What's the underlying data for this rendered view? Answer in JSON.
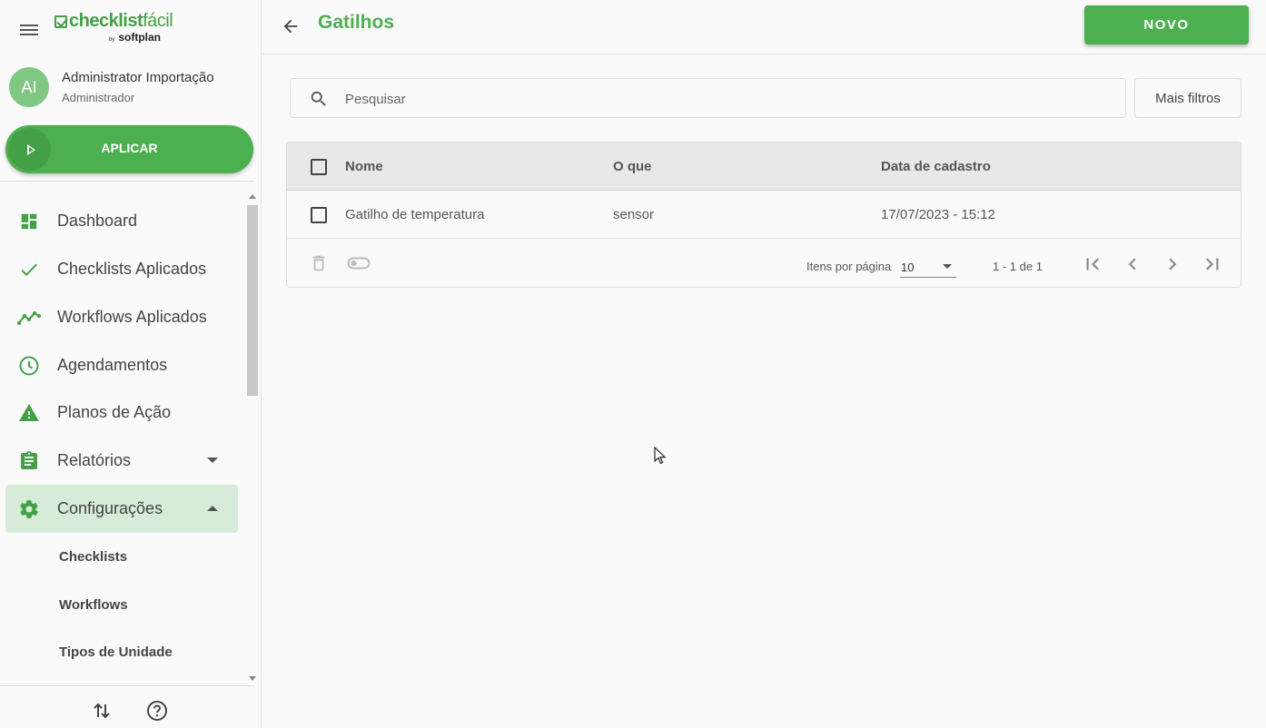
{
  "brand": {
    "name_bold": "checklist",
    "name_light": "fácil",
    "by": "by",
    "sub": "softplan"
  },
  "user": {
    "initials": "AI",
    "name": "Administrator Importação",
    "role": "Administrador"
  },
  "sidebar": {
    "apply_label": "APLICAR",
    "items": [
      {
        "label": "Dashboard",
        "icon": "dashboard-icon"
      },
      {
        "label": "Checklists Aplicados",
        "icon": "check-icon"
      },
      {
        "label": "Workflows Aplicados",
        "icon": "trending-icon"
      },
      {
        "label": "Agendamentos",
        "icon": "clock-icon"
      },
      {
        "label": "Planos de Ação",
        "icon": "warning-icon"
      },
      {
        "label": "Relatórios",
        "icon": "clipboard-icon"
      },
      {
        "label": "Configurações",
        "icon": "gear-icon",
        "active": true
      }
    ],
    "subitems": [
      {
        "label": "Checklists"
      },
      {
        "label": "Workflows"
      },
      {
        "label": "Tipos de Unidade"
      }
    ]
  },
  "header": {
    "title": "Gatilhos",
    "new_button": "NOVO"
  },
  "search": {
    "placeholder": "Pesquisar",
    "value": "",
    "more_filters": "Mais filtros"
  },
  "table": {
    "columns": [
      "Nome",
      "O que",
      "Data de cadastro"
    ],
    "rows": [
      {
        "name": "Gatilho de temperatura",
        "what": "sensor",
        "date": "17/07/2023 - 15:12"
      }
    ],
    "pagination": {
      "per_page_label": "Itens por página",
      "per_page": "10",
      "range": "1 - 1 de 1"
    }
  },
  "colors": {
    "brand_green": "#4caf50",
    "active_bg": "#d7ecd8"
  }
}
